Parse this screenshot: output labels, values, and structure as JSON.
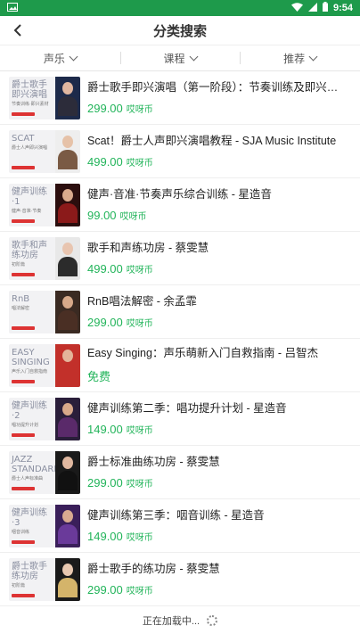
{
  "status": {
    "time": "9:54"
  },
  "header": {
    "title": "分类搜索"
  },
  "filters": [
    {
      "label": "声乐"
    },
    {
      "label": "课程"
    },
    {
      "label": "推荐"
    }
  ],
  "items": [
    {
      "title": "爵士歌手即兴演唱（第一阶段）：节奏训练及即兴素…",
      "price": "299.00",
      "currency": "哎呀币",
      "thumb_text": "爵士歌手即兴演唱",
      "thumb_sub": "节奏训练·即兴素材",
      "photo_bg": "#1d2a4a",
      "skin": "#e1b7a0",
      "cloth": "#2c2c3a"
    },
    {
      "title": "Scat！爵士人声即兴演唱教程 - SJA Music Institute",
      "price": "499.00",
      "currency": "哎呀币",
      "thumb_text": "SCAT",
      "thumb_sub": "爵士人声即兴演唱",
      "photo_bg": "#eeeeee",
      "skin": "#e6c2a8",
      "cloth": "#7a5a44"
    },
    {
      "title": "健声·音准·节奏声乐综合训练 - 星造音",
      "price": "99.00",
      "currency": "哎呀币",
      "thumb_text": "健声训练·1",
      "thumb_sub": "健声·音准·节奏",
      "photo_bg": "#2b0e0e",
      "skin": "#d9a98c",
      "cloth": "#8b1a1a"
    },
    {
      "title": "歌手和声练功房 - 蔡雯慧",
      "price": "499.00",
      "currency": "哎呀币",
      "thumb_text": "歌手和声练功房",
      "thumb_sub": "初阶篇",
      "photo_bg": "#e8e8e8",
      "skin": "#e8c5b0",
      "cloth": "#2b2b2b"
    },
    {
      "title": "RnB唱法解密 - 余孟霏",
      "price": "299.00",
      "currency": "哎呀币",
      "thumb_text": "RnB",
      "thumb_sub": "唱法解密",
      "photo_bg": "#3a2a22",
      "skin": "#d7a98a",
      "cloth": "#4a2f24"
    },
    {
      "title": "Easy Singing：声乐萌新入门自救指南 - 吕智杰",
      "price": "免费",
      "currency": "",
      "thumb_text": "EASY SINGING",
      "thumb_sub": "声乐入门自救指南",
      "photo_bg": "#c2302a",
      "skin": "#e4b49a",
      "cloth": "#c2302a"
    },
    {
      "title": "健声训练第二季：唱功提升计划 - 星造音",
      "price": "149.00",
      "currency": "哎呀币",
      "thumb_text": "健声训练·2",
      "thumb_sub": "唱功提升计划",
      "photo_bg": "#2a1e3a",
      "skin": "#d8a88a",
      "cloth": "#5a2a6a"
    },
    {
      "title": "爵士标准曲练功房 - 蔡雯慧",
      "price": "299.00",
      "currency": "哎呀币",
      "thumb_text": "JAZZ STANDARD",
      "thumb_sub": "爵士人声标准曲",
      "photo_bg": "#1a1a1a",
      "skin": "#e0b8a0",
      "cloth": "#111"
    },
    {
      "title": "健声训练第三季：咽音训练 - 星造音",
      "price": "149.00",
      "currency": "哎呀币",
      "thumb_text": "健声训练·3",
      "thumb_sub": "咽音训练",
      "photo_bg": "#3a1f5a",
      "skin": "#d8aa90",
      "cloth": "#6a3a9a"
    },
    {
      "title": "爵士歌手的练功房 - 蔡雯慧",
      "price": "299.00",
      "currency": "哎呀币",
      "thumb_text": "爵士歌手练功房",
      "thumb_sub": "初阶篇",
      "photo_bg": "#1a1a1a",
      "skin": "#e8c8b0",
      "cloth": "#d4b46a"
    }
  ],
  "loading_text": "正在加载中...",
  "colors": {
    "accent": "#22b45a",
    "status_bar": "#1e9a4b"
  }
}
